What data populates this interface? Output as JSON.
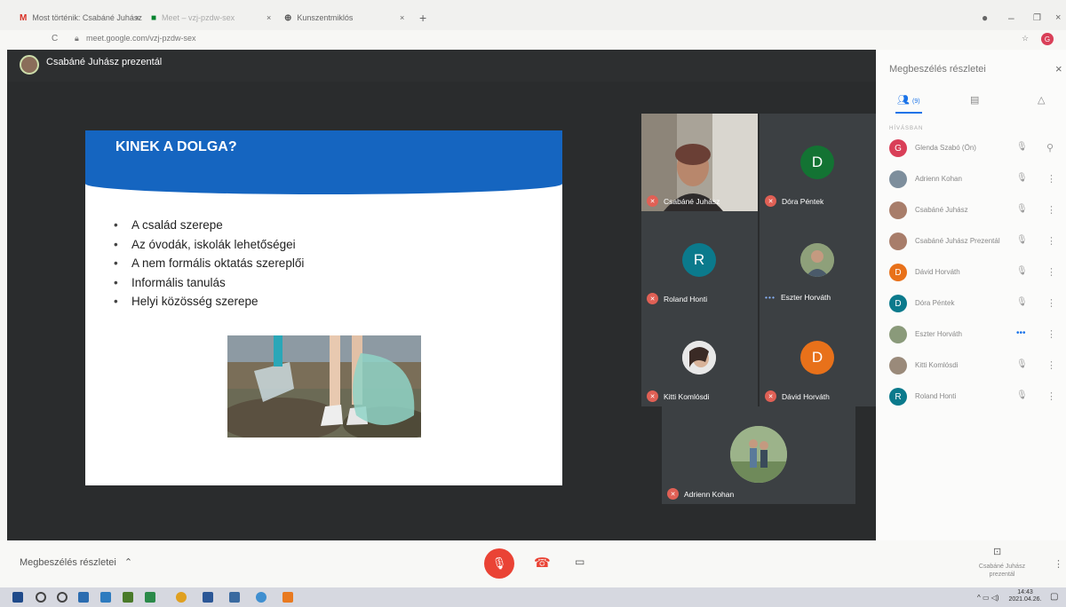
{
  "browser": {
    "tabs": [
      {
        "label": "Most történik: Csabáné Juhász"
      },
      {
        "label": "Meet – vzj-pzdw-sex"
      },
      {
        "label": "Kunszentmiklós"
      }
    ],
    "address": "meet.google.com/vzj-pzdw-sex",
    "profile_initial": "G"
  },
  "meet": {
    "presenter_label": "Csabáné Juhász prezentál",
    "details_label": "Megbeszélés részletei",
    "present_label": "Csabáné Juhász prezentál"
  },
  "slide": {
    "title": "KINEK A DOLGA?",
    "bullets": [
      "A család szerepe",
      "Az óvodák, iskolák lehetőségei",
      "A nem formális oktatás szereplői",
      "Informális tanulás",
      "Helyi közösség szerepe"
    ]
  },
  "tiles": [
    {
      "name": "Csabáné Juhász",
      "initial": "",
      "color": "",
      "status": "muted"
    },
    {
      "name": "Dóra Péntek",
      "initial": "D",
      "color": "#137333",
      "status": "muted"
    },
    {
      "name": "Roland Honti",
      "initial": "R",
      "color": "#0b7a8c",
      "status": "muted"
    },
    {
      "name": "Eszter Horváth",
      "initial": "",
      "color": "",
      "status": "speaking"
    },
    {
      "name": "Kitti Komlósdi",
      "initial": "",
      "color": "",
      "status": "muted"
    },
    {
      "name": "Dávid Horváth",
      "initial": "D",
      "color": "#e8711a",
      "status": "muted"
    },
    {
      "name": "Adrienn Kohan",
      "initial": "",
      "color": "",
      "status": "muted"
    }
  ],
  "panel": {
    "title": "Megbeszélés részletei",
    "people_count": "(9)",
    "section": "HÍVÁSBAN",
    "participants": [
      {
        "name": "Glenda Szabó (Ön)",
        "initial": "G",
        "color": "#d93f58"
      },
      {
        "name": "Adrienn Kohan",
        "initial": "",
        "color": "#7d8e9c"
      },
      {
        "name": "Csabáné Juhász",
        "initial": "",
        "color": "#a87d6a"
      },
      {
        "name": "Csabáné Juhász Prezentál",
        "initial": "",
        "color": "#a87d6a"
      },
      {
        "name": "Dávid Horváth",
        "initial": "D",
        "color": "#e8711a"
      },
      {
        "name": "Dóra Péntek",
        "initial": "D",
        "color": "#0b7a8c"
      },
      {
        "name": "Eszter Horváth",
        "initial": "",
        "color": "#8a9a7a"
      },
      {
        "name": "Kitti Komlósdi",
        "initial": "",
        "color": "#9a8a7a"
      },
      {
        "name": "Roland Honti",
        "initial": "R",
        "color": "#0b7a8c"
      }
    ]
  },
  "taskbar": {
    "time": "14:43",
    "date": "2021.04.26."
  },
  "colors": {
    "accent": "#1a73e8",
    "slide_blue": "#1565c0",
    "leave_red": "#ea4335",
    "muted_red": "#e06055"
  }
}
